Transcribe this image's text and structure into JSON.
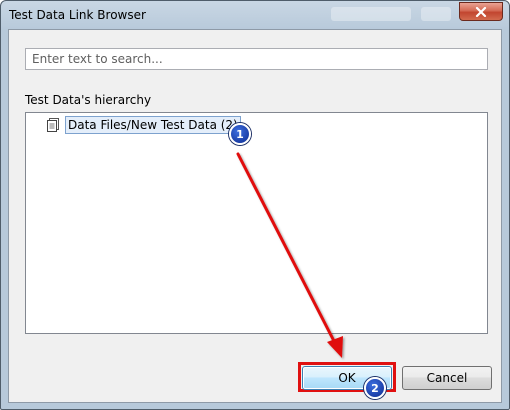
{
  "window": {
    "title": "Test Data Link Browser"
  },
  "search": {
    "placeholder": "Enter text to search..."
  },
  "hierarchy": {
    "label": "Test Data's hierarchy",
    "items": [
      {
        "label": "Data Files/New Test Data (2)",
        "icon": "document-icon"
      }
    ]
  },
  "buttons": {
    "ok": "OK",
    "cancel": "Cancel"
  },
  "annotations": {
    "step1": "1",
    "step2": "2"
  },
  "colors": {
    "annotation_red": "#e01010",
    "badge_blue": "#1b3fa8"
  }
}
